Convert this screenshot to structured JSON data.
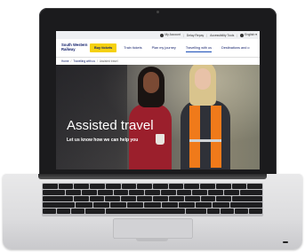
{
  "site": {
    "utility_bar": {
      "items": [
        "My Account",
        "Delay Repay",
        "Accessibility Tools",
        "English"
      ]
    },
    "logo": {
      "line1": "South Western",
      "line2": "Railway"
    },
    "nav": {
      "buy_tickets": "Buy tickets",
      "items": [
        "Train tickets",
        "Plan my journey",
        "Travelling with us",
        "Destinations and o"
      ]
    },
    "breadcrumb": {
      "home": "Home",
      "parent": "Travelling with us",
      "current": "Assisted travel"
    },
    "hero": {
      "title": "Assisted travel",
      "subtitle": "Let us know how we can help you"
    }
  },
  "colors": {
    "brand_navy": "#13206b",
    "buy_button": "#f5d10f",
    "active_underline": "#1a4db8"
  }
}
